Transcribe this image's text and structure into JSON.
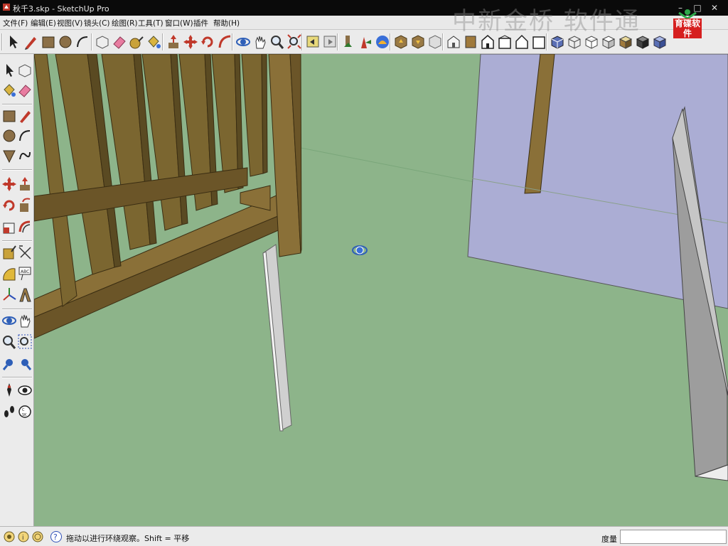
{
  "window": {
    "title": "秋千3.skp - SketchUp Pro"
  },
  "menu": [
    "文件(F)",
    "编辑(E)",
    "视图(V)",
    "镜头(C)",
    "绘图(R)",
    "工具(T)",
    "窗口(W)",
    "插件",
    "帮助(H)"
  ],
  "watermark": "中新金桥 软件通",
  "logo": {
    "text": "育碟软件"
  },
  "toolbar_icons": [
    "select-icon",
    "pencil-icon",
    "rectangle-icon",
    "circle-icon",
    "arc-icon",
    "make-component-icon",
    "eraser-icon",
    "tape-measure-icon",
    "paint-bucket-icon",
    "push-pull-icon",
    "move-icon",
    "rotate-icon",
    "follow-me-icon",
    "orbit-icon",
    "pan-icon",
    "zoom-icon",
    "zoom-extents-icon",
    "previous-view-icon",
    "next-view-icon",
    "position-camera-icon",
    "walk-icon",
    "look-around-icon",
    "get-models-icon",
    "share-model-icon",
    "share-component-icon",
    "get-photo-texture-icon",
    "iso-view-icon",
    "top-view-icon",
    "front-view-icon",
    "right-view-icon",
    "back-view-icon",
    "left-view-icon",
    "xray-icon",
    "wireframe-icon",
    "hidden-line-icon",
    "shaded-icon",
    "shaded-textures-icon",
    "monochrome-icon"
  ],
  "left_tools": [
    "select-icon",
    "make-component-icon",
    "paint-bucket-icon",
    "eraser-icon",
    "rectangle-icon",
    "line-icon",
    "circle-icon",
    "arc-icon",
    "polygon-icon",
    "freehand-icon",
    "move-icon",
    "push-pull-icon",
    "rotate-icon",
    "follow-me-icon",
    "scale-icon",
    "offset-icon",
    "tape-measure-icon",
    "dimension-icon",
    "protractor-icon",
    "text-icon",
    "axes-icon",
    "3d-text-icon",
    "orbit-icon",
    "pan-icon",
    "zoom-icon",
    "zoom-window-icon",
    "zoom-extents-icon",
    "previous-icon",
    "position-camera-icon",
    "look-around-icon",
    "walk-icon",
    "section-plane-icon"
  ],
  "status": {
    "hint": "拖动以进行环绕观察。Shift = 平移",
    "measure_label": "度量",
    "measure_value": ""
  },
  "colors": {
    "ground": "#8db48a",
    "wood": "#7b6630",
    "panel": "#abadd4",
    "board": "#c8c8c8"
  }
}
